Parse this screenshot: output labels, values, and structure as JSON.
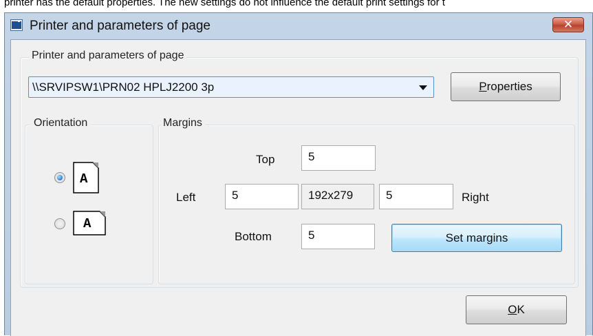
{
  "background_text": "printer has the default properties. The new settings do not influence the default print settings for t",
  "window": {
    "title": "Printer and parameters of page",
    "close_glyph": "✕",
    "icon": "window-app-icon"
  },
  "printer_group": {
    "legend": "Printer and parameters of page",
    "selected_printer": "\\\\SRVIPSW1\\PRN02 HPLJ2200 3p",
    "properties_button": {
      "label": "roperties",
      "mnemonic": "P"
    }
  },
  "orientation_group": {
    "legend": "Orientation",
    "options": [
      {
        "name": "portrait",
        "icon_letter": "A",
        "checked": true
      },
      {
        "name": "landscape",
        "icon_letter": "A",
        "checked": false
      }
    ]
  },
  "margins_group": {
    "legend": "Margins",
    "top_label": "Top",
    "top_value": "5",
    "left_label": "Left",
    "left_value": "5",
    "page_size": "192x279",
    "right_value": "5",
    "right_label": "Right",
    "bottom_label": "Bottom",
    "bottom_value": "5",
    "set_margins_button": "Set margins"
  },
  "ok_button": {
    "label": "K",
    "mnemonic": "O"
  },
  "colors": {
    "title_bar": "#c4d5e8",
    "client_bg": "#f0f0f0",
    "focus_accent": "#3c7fb1",
    "close_button": "#c95d45"
  }
}
